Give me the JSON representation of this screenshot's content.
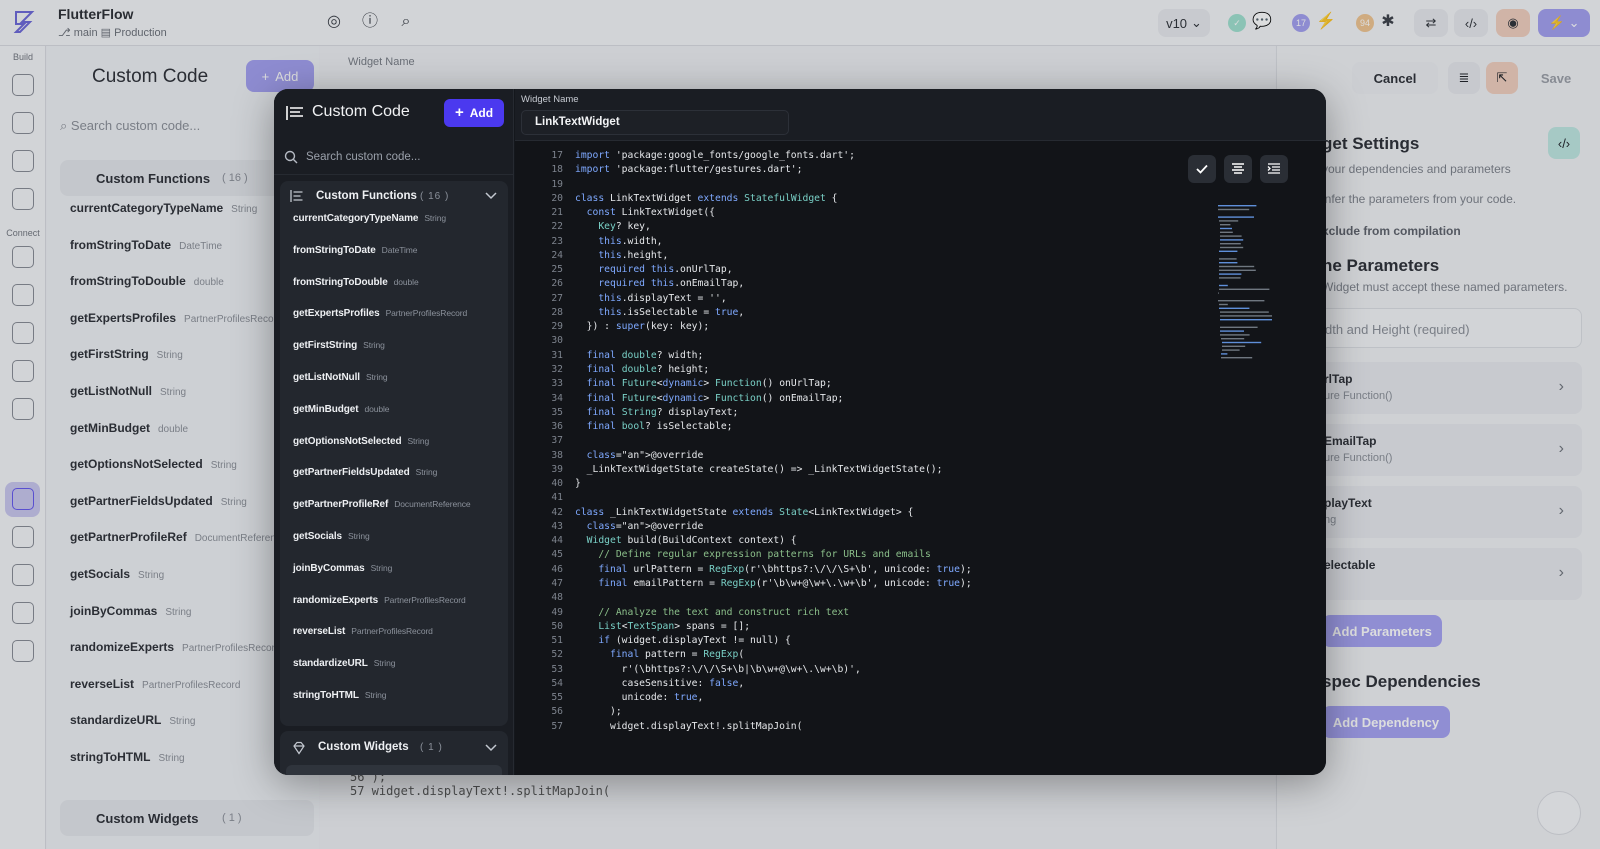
{
  "app": {
    "name": "FlutterFlow",
    "branch": "main",
    "environment": "Production",
    "version": "v10",
    "badges": {
      "notifications": "17",
      "bugs": "94"
    }
  },
  "rail": {
    "build_label": "Build",
    "connect_label": "Connect"
  },
  "background": {
    "panel_title": "Custom Code",
    "add_label": "Add",
    "search_placeholder": "Search custom code...",
    "functions_label": "Custom Functions",
    "functions_count": "( 16 )",
    "widgets_label": "Custom Widgets",
    "widgets_count": "( 1 )",
    "widget_name_label": "Widget Name",
    "widget_name_value": "LinkTextWidget",
    "code_peek": [
      "56  );",
      "57  widget.displayText!.splitMapJoin("
    ],
    "cancel_label": "Cancel",
    "save_label": "Save",
    "settings_title": "get Settings",
    "settings_sub": "your dependencies and parameters",
    "infer_text": "infer the parameters from your code.",
    "exclude_label": "xclude from compilation",
    "params_title": "ne Parameters",
    "params_sub": "Widget must accept these named parameters.",
    "size_field": "dth and Height (required)",
    "params": [
      {
        "name": "rlTap",
        "type": "ure Function()"
      },
      {
        "name": "EmailTap",
        "type": "ure Function()"
      },
      {
        "name": "playText",
        "type": "ng"
      },
      {
        "name": "electable",
        "type": "l"
      }
    ],
    "add_params_label": "Add Parameters",
    "deps_title": "spec Dependencies",
    "add_dependency_label": "Add Dependency"
  },
  "modal": {
    "title": "Custom Code",
    "add_label": "Add",
    "search_placeholder": "Search custom code...",
    "functions_label": "Custom Functions",
    "functions_count": "( 16 )",
    "widgets_label": "Custom Widgets",
    "widgets_count": "( 1 )",
    "widget_name_label": "Widget Name",
    "widget_name_value": "LinkTextWidget"
  },
  "functions": [
    {
      "name": "currentCategoryTypeName",
      "type": "String"
    },
    {
      "name": "fromStringToDate",
      "type": "DateTime"
    },
    {
      "name": "fromStringToDouble",
      "type": "double"
    },
    {
      "name": "getExpertsProfiles",
      "type": "PartnerProfilesRecord"
    },
    {
      "name": "getFirstString",
      "type": "String"
    },
    {
      "name": "getListNotNull",
      "type": "String"
    },
    {
      "name": "getMinBudget",
      "type": "double"
    },
    {
      "name": "getOptionsNotSelected",
      "type": "String"
    },
    {
      "name": "getPartnerFieldsUpdated",
      "type": "String"
    },
    {
      "name": "getPartnerProfileRef",
      "type": "DocumentReference"
    },
    {
      "name": "getSocials",
      "type": "String"
    },
    {
      "name": "joinByCommas",
      "type": "String"
    },
    {
      "name": "randomizeExperts",
      "type": "PartnerProfilesRecord"
    },
    {
      "name": "reverseList",
      "type": "PartnerProfilesRecord"
    },
    {
      "name": "standardizeURL",
      "type": "String"
    },
    {
      "name": "stringToHTML",
      "type": "String"
    }
  ],
  "code": {
    "line_numbers": [
      "17",
      "18",
      "19",
      "20",
      "21",
      "22",
      "23",
      "24",
      "25",
      "26",
      "27",
      "28",
      "29",
      "30",
      "31",
      "32",
      "33",
      "34",
      "35",
      "36",
      "37",
      "38",
      "39",
      "40",
      "41",
      "42",
      "43",
      "44",
      "45",
      "46",
      "47",
      "48",
      "49",
      "50",
      "51",
      "52",
      "53",
      "54",
      "55",
      "56",
      "57"
    ],
    "lines": [
      "import 'package:google_fonts/google_fonts.dart';",
      "import 'package:flutter/gestures.dart';",
      "",
      "class LinkTextWidget extends StatefulWidget {",
      "  const LinkTextWidget({",
      "    Key? key,",
      "    this.width,",
      "    this.height,",
      "    required this.onUrlTap,",
      "    required this.onEmailTap,",
      "    this.displayText = '',",
      "    this.isSelectable = true,",
      "  }) : super(key: key);",
      "",
      "  final double? width;",
      "  final double? height;",
      "  final Future<dynamic> Function() onUrlTap;",
      "  final Future<dynamic> Function() onEmailTap;",
      "  final String? displayText;",
      "  final bool? isSelectable;",
      "",
      "  @override",
      "  _LinkTextWidgetState createState() => _LinkTextWidgetState();",
      "}",
      "",
      "class _LinkTextWidgetState extends State<LinkTextWidget> {",
      "  @override",
      "  Widget build(BuildContext context) {",
      "    // Define regular expression patterns for URLs and emails",
      "    final urlPattern = RegExp(r'\\bhttps?:\\/\\/\\S+\\b', unicode: true);",
      "    final emailPattern = RegExp(r'\\b\\w+@\\w+\\.\\w+\\b', unicode: true);",
      "",
      "    // Analyze the text and construct rich text",
      "    List<TextSpan> spans = [];",
      "    if (widget.displayText != null) {",
      "      final pattern = RegExp(",
      "        r'(\\bhttps?:\\/\\/\\S+\\b|\\b\\w+@\\w+\\.\\w+\\b)',",
      "        caseSensitive: false,",
      "        unicode: true,",
      "      );",
      "      widget.displayText!.splitMapJoin("
    ]
  }
}
